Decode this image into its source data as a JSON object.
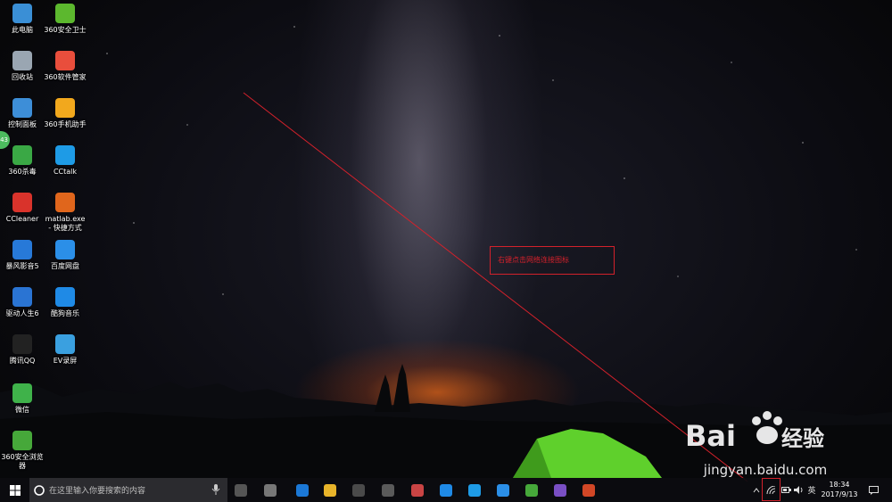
{
  "desktop_icons": [
    {
      "label": "此电脑",
      "icon": "computer-icon",
      "color": "#3a8fd6"
    },
    {
      "label": "360安全卫士",
      "icon": "shield-360-icon",
      "color": "#5cb82e"
    },
    {
      "label": "回收站",
      "icon": "recycle-bin-icon",
      "color": "#9aa6b2"
    },
    {
      "label": "360软件管家",
      "icon": "software-manager-icon",
      "color": "#e94e3c"
    },
    {
      "label": "控制面板",
      "icon": "control-panel-icon",
      "color": "#3d8ed8"
    },
    {
      "label": "360手机助手",
      "icon": "phone-assistant-icon",
      "color": "#f2a81d"
    },
    {
      "label": "360杀毒",
      "icon": "antivirus-icon",
      "color": "#3aa845"
    },
    {
      "label": "CCtalk",
      "icon": "cctalk-icon",
      "color": "#1e9be6"
    },
    {
      "label": "CCleaner",
      "icon": "ccleaner-icon",
      "color": "#d9332b"
    },
    {
      "label": "matlab.exe - 快捷方式",
      "icon": "matlab-icon",
      "color": "#e0661c"
    },
    {
      "label": "暴风影音5",
      "icon": "baofeng-icon",
      "color": "#2779d8"
    },
    {
      "label": "百度网盘",
      "icon": "baidu-netdisk-icon",
      "color": "#2b8fe8"
    },
    {
      "label": "驱动人生6",
      "icon": "driver-icon",
      "color": "#2a74d3"
    },
    {
      "label": "酷狗音乐",
      "icon": "kugou-icon",
      "color": "#1f8ae6"
    },
    {
      "label": "腾讯QQ",
      "icon": "qq-icon",
      "color": "#222222"
    },
    {
      "label": "EV录屏",
      "icon": "ev-recorder-icon",
      "color": "#3aa0e0"
    },
    {
      "label": "微信",
      "icon": "wechat-icon",
      "color": "#3fb24a"
    },
    {
      "label": "360安全浏览器",
      "icon": "browser-360-icon",
      "color": "#46a83a"
    }
  ],
  "side_badge": "43",
  "annotation": {
    "text": "右键点击网络连接图标",
    "color": "#d3212b"
  },
  "watermark": {
    "text": "jingyan.baidu.com"
  },
  "taskbar": {
    "search_placeholder": "在这里输入你要搜索的内容",
    "apps": [
      {
        "icon": "task-view-icon",
        "color": "#555555"
      },
      {
        "icon": "fan-app-icon",
        "color": "#777777"
      },
      {
        "icon": "edge-icon",
        "color": "#1b78d6"
      },
      {
        "icon": "file-explorer-icon",
        "color": "#e8b42a"
      },
      {
        "icon": "store-icon",
        "color": "#4a4a4a"
      },
      {
        "icon": "mail-icon",
        "color": "#5a5a5a"
      },
      {
        "icon": "paint-icon",
        "color": "#c94444"
      },
      {
        "icon": "kugou-taskbar-icon",
        "color": "#1f8ae6"
      },
      {
        "icon": "cctalk-taskbar-icon",
        "color": "#1e9be6"
      },
      {
        "icon": "baidu-netdisk-taskbar-icon",
        "color": "#2b8fe8"
      },
      {
        "icon": "browser-360-taskbar-icon",
        "color": "#46a83a"
      },
      {
        "icon": "visual-studio-icon",
        "color": "#7a4fc4"
      },
      {
        "icon": "powerpoint-icon",
        "color": "#d24726"
      }
    ],
    "ime": "英",
    "clock_time": "18:34",
    "clock_date": "2017/9/13"
  }
}
